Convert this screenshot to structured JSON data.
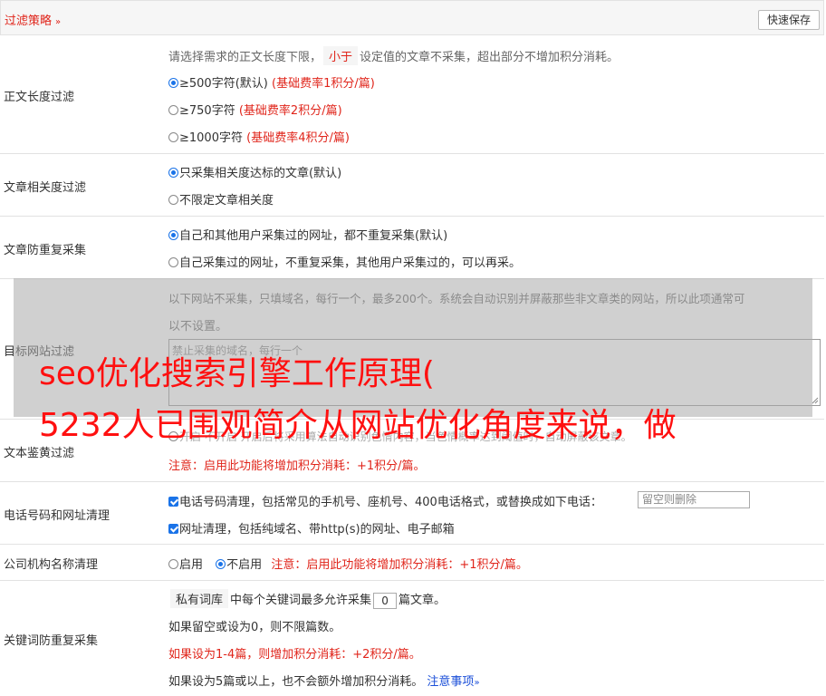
{
  "header": {
    "title": "过滤策略",
    "save_label": "快速保存"
  },
  "length_filter": {
    "label": "正文长度过滤",
    "desc_before": "请选择需求的正文长度下限，",
    "desc_tag": "小于",
    "desc_after": "设定值的文章不采集，超出部分不增加积分消耗。",
    "options": [
      {
        "text": "≥500字符(默认)",
        "note": "(基础费率1积分/篇)",
        "selected": true
      },
      {
        "text": "≥750字符",
        "note": "(基础费率2积分/篇)",
        "selected": false
      },
      {
        "text": "≥1000字符",
        "note": "(基础费率4积分/篇)",
        "selected": false
      }
    ]
  },
  "relevance_filter": {
    "label": "文章相关度过滤",
    "options": [
      {
        "text": "只采集相关度达标的文章(默认)",
        "selected": true
      },
      {
        "text": "不限定文章相关度",
        "selected": false
      }
    ]
  },
  "dup_filter": {
    "label": "文章防重复采集",
    "options": [
      {
        "text": "自己和其他用户采集过的网址，都不重复采集(默认)",
        "selected": true
      },
      {
        "text": "自己采集过的网址，不重复采集，其他用户采集过的，可以再采。",
        "selected": false
      }
    ]
  },
  "site_filter": {
    "label": "目标网站过滤",
    "desc_line1": "以下网站不采集，只填域名，每行一个，最多200个。系统会自动识别并屏蔽那些非文章类的网站，所以此项通常可",
    "desc_line2": "以不设置。",
    "placeholder": "禁止采集的域名，每行一个"
  },
  "porn_filter": {
    "label": "文本鉴黄过滤",
    "hidden_line": "开启 不开启 开启后将采用算法自动识别色情内容，当色情概率达到阈值时，自动屏蔽该文章。",
    "note": "注意：启用此功能将增加积分消耗：+1积分/篇。"
  },
  "phone_filter": {
    "label": "电话号码和网址清理",
    "phone_text": "电话号码清理，包括常见的手机号、座机号、400电话格式，或替换成如下电话：",
    "phone_placeholder": "留空则删除",
    "url_text": "网址清理，包括纯域名、带http(s)的网址、电子邮箱"
  },
  "company_filter": {
    "label": "公司机构名称清理",
    "enable": "启用",
    "disable": "不启用",
    "note": "注意：启用此功能将增加积分消耗：+1积分/篇。"
  },
  "keyword_filter": {
    "label": "关键词防重复采集",
    "tag": "私有词库",
    "line1_before": "中每个关键词最多允许采集",
    "count": "0",
    "line1_after": "篇文章。",
    "line2": "如果留空或设为0，则不限篇数。",
    "line3": "如果设为1-4篇，则增加积分消耗：+2积分/篇。",
    "line4": "如果设为5篇或以上，也不会额外增加积分消耗。",
    "notice_link": "注意事项"
  },
  "watermark": {
    "line1": "seo优化搜索引擎工作原理(",
    "line2": "5232人已围观简介从网站优化角度来说，做"
  },
  "colors": {
    "accent_red": "#e0251b",
    "link_blue": "#1a4ed8",
    "radio_blue": "#1a73e8"
  }
}
